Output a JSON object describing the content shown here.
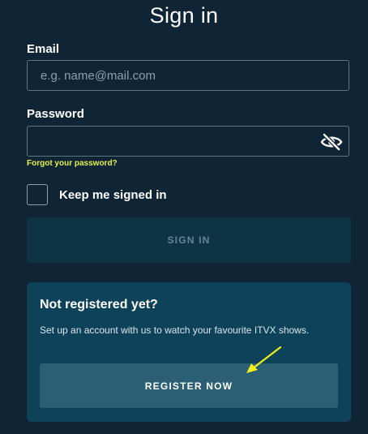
{
  "page": {
    "title": "Sign in"
  },
  "form": {
    "email_label": "Email",
    "email_placeholder": "e.g. name@mail.com",
    "email_value": "",
    "password_label": "Password",
    "password_value": "",
    "forgot_password": "Forgot your password?",
    "keep_signed_in_label": "Keep me signed in",
    "keep_signed_in_checked": false,
    "sign_in_button": "SIGN IN",
    "password_toggle_icon": "eye-slash-icon"
  },
  "register": {
    "heading": "Not registered yet?",
    "text": "Set up an account with us to watch your favourite ITVX shows.",
    "button": "REGISTER NOW"
  },
  "colors": {
    "background": "#0f2434",
    "forgot_link": "#e6f04a",
    "signin_button_bg": "#0e3345",
    "register_card_bg": "#0d4259",
    "register_button_bg": "#2b5f73",
    "annotation_arrow": "#f2ef1b"
  }
}
